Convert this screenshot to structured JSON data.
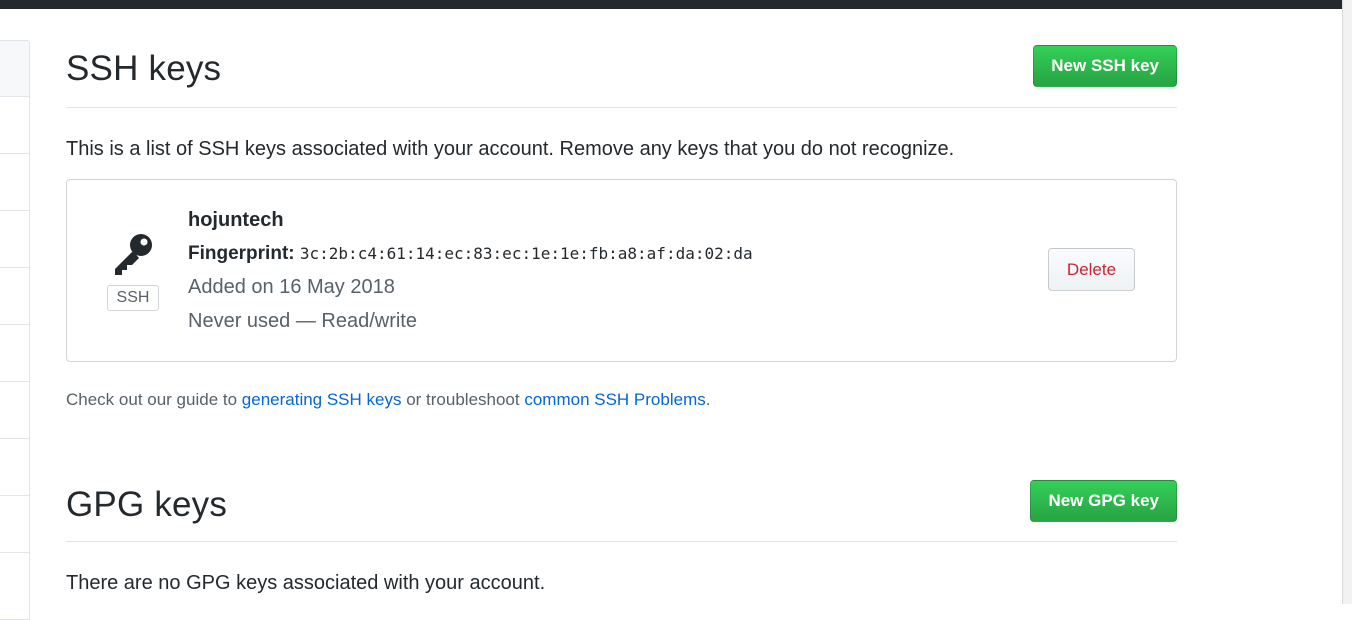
{
  "ssh": {
    "title": "SSH keys",
    "new_button": "New SSH key",
    "description": "This is a list of SSH keys associated with your account. Remove any keys that you do not recognize.",
    "key": {
      "name": "hojuntech",
      "fingerprint_label": "Fingerprint:",
      "fingerprint": "3c:2b:c4:61:14:ec:83:ec:1e:1e:fb:a8:af:da:02:da",
      "type_label": "SSH",
      "added": "Added on 16 May 2018",
      "usage": "Never used — Read/write",
      "delete_button": "Delete",
      "icon": "key-icon"
    },
    "guide": {
      "prefix": "Check out our guide to ",
      "link1": "generating SSH keys",
      "middle": " or troubleshoot ",
      "link2": "common SSH Problems",
      "suffix": "."
    }
  },
  "gpg": {
    "title": "GPG keys",
    "new_button": "New GPG key",
    "description": "There are no GPG keys associated with your account."
  },
  "colors": {
    "primary_button": "#28a745",
    "danger_text": "#cb2431",
    "link": "#0366d6",
    "topbar": "#24292e"
  }
}
